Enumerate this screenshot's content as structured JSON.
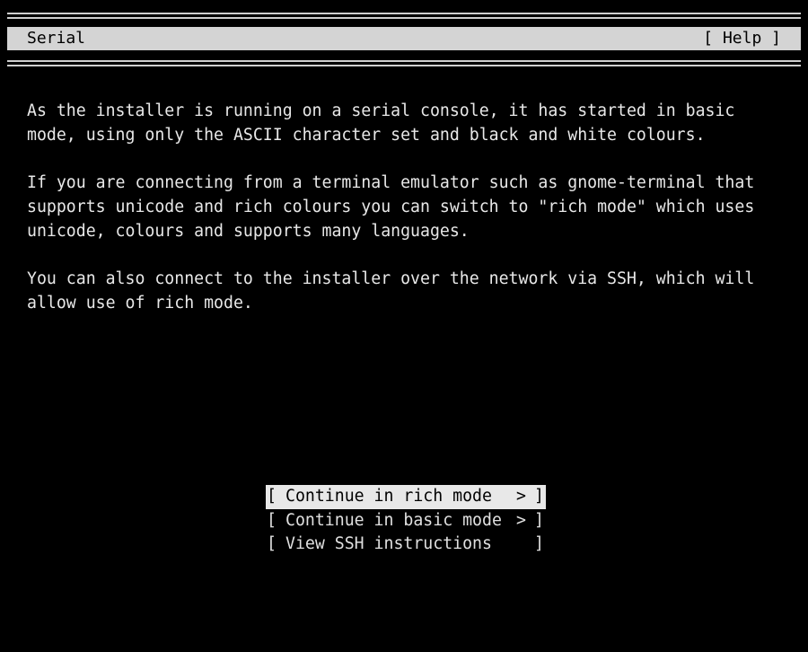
{
  "header": {
    "title": "Serial",
    "help_label": "[ Help ]"
  },
  "body": {
    "para1_l1": "As the installer is running on a serial console, it has started in basic",
    "para1_l2": "mode, using only the ASCII character set and black and white colours.",
    "para2_l1": "If you are connecting from a terminal emulator such as gnome-terminal that",
    "para2_l2": "supports unicode and rich colours you can switch to \"rich mode\" which uses",
    "para2_l3": "unicode, colours and supports many languages.",
    "para3_l1": "You can also connect to the installer over the network via SSH, which will",
    "para3_l2": "allow use of rich mode."
  },
  "buttons": [
    {
      "label": "Continue in rich mode",
      "arrow": ">",
      "selected": true
    },
    {
      "label": "Continue in basic mode",
      "arrow": ">",
      "selected": false
    },
    {
      "label": "View SSH instructions",
      "arrow": "",
      "selected": false
    }
  ],
  "colors": {
    "background": "#000000",
    "titlebar": "#d4d4d4",
    "foreground": "#e6e6e6"
  }
}
